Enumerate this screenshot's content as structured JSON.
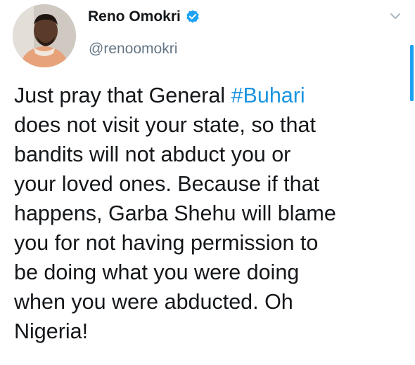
{
  "author": {
    "display_name": "Reno Omokri",
    "handle": "@renoomokri",
    "verified": true
  },
  "tweet": {
    "lines": [
      {
        "before": "Just pray that General ",
        "hashtag": "#Buhari"
      },
      {
        "text": "does not visit your state, so that"
      },
      {
        "text": "bandits will not abduct you or"
      },
      {
        "text": "your loved ones. Because if that"
      },
      {
        "text": "happens, Garba Shehu will blame"
      },
      {
        "text": "you for not having permission to"
      },
      {
        "text": "be doing what you were doing"
      },
      {
        "text": "when you were abducted. Oh"
      },
      {
        "text": "Nigeria!"
      }
    ]
  },
  "icons": {
    "verified": "verified-badge-icon",
    "menu": "chevron-down-icon"
  },
  "colors": {
    "hashtag": "#1b95e0",
    "verified": "#1da1f2",
    "text": "#14171a",
    "handle": "#657786"
  }
}
